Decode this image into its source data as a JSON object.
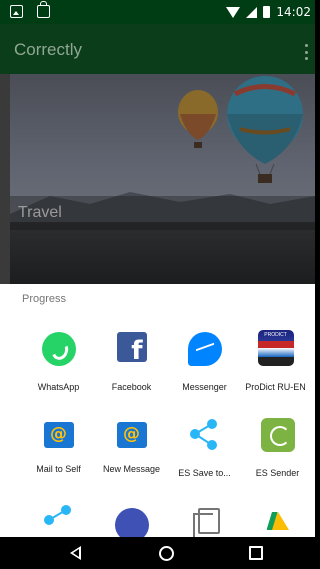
{
  "status_bar": {
    "time": "14:02",
    "icons": [
      "image-icon",
      "shopping-bag-icon",
      "wifi-icon",
      "cell-signal-icon",
      "battery-icon"
    ]
  },
  "app_bar": {
    "title": "Correctly",
    "overflow_icon": "overflow-menu-icon"
  },
  "card": {
    "title": "Travel",
    "image": "hot-air-balloons-photo"
  },
  "share_sheet": {
    "title": "Progress",
    "apps": [
      {
        "label": "WhatsApp",
        "icon": "whatsapp-icon"
      },
      {
        "label": "Facebook",
        "icon": "facebook-icon"
      },
      {
        "label": "Messenger",
        "icon": "messenger-icon"
      },
      {
        "label": "ProDict RU-EN",
        "icon": "prodict-icon",
        "badge": "PRODICT"
      },
      {
        "label": "Mail to Self",
        "icon": "mail-icon"
      },
      {
        "label": "New Message",
        "icon": "mail-icon"
      },
      {
        "label": "ES Save to...",
        "icon": "share-icon"
      },
      {
        "label": "ES Sender",
        "icon": "es-sender-icon"
      }
    ],
    "partial_row_icons": [
      "share-icon",
      "message-icon",
      "copy-icon",
      "google-drive-icon"
    ]
  },
  "nav_bar": {
    "buttons": [
      "back-icon",
      "home-icon",
      "recents-icon"
    ]
  },
  "colors": {
    "status_bar": "#003d14",
    "app_bar_dimmed": "#0b3d1a",
    "sheet_background": "#ffffff",
    "whatsapp": "#25d366",
    "facebook": "#3b5998",
    "messenger": "#0084ff",
    "es_sender": "#7cb342"
  }
}
